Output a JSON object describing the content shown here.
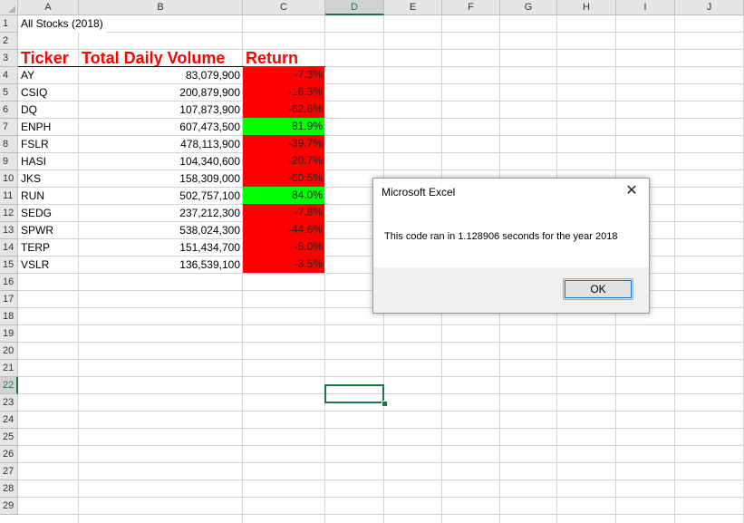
{
  "columns": [
    "A",
    "B",
    "C",
    "D",
    "E",
    "F",
    "G",
    "H",
    "I",
    "J"
  ],
  "selected_column": "D",
  "rows": [
    "1",
    "2",
    "3",
    "4",
    "5",
    "6",
    "7",
    "8",
    "9",
    "10",
    "11",
    "12",
    "13",
    "14",
    "15",
    "16",
    "17",
    "18",
    "19",
    "20",
    "21",
    "22",
    "23",
    "24",
    "25",
    "26",
    "27",
    "28",
    "29"
  ],
  "selected_row": "22",
  "sheet_title": "All Stocks (2018)",
  "headers": {
    "ticker": "Ticker",
    "volume": "Total Daily Volume",
    "return": "Return"
  },
  "colors": {
    "positive": "#00ff00",
    "negative": "#ff0000",
    "header_text": "#ff0000",
    "accent": "#217346"
  },
  "stocks": [
    {
      "ticker": "AY",
      "volume": "83,079,900",
      "return": "-7.3%",
      "positive": false
    },
    {
      "ticker": "CSIQ",
      "volume": "200,879,900",
      "return": "-16.3%",
      "positive": false
    },
    {
      "ticker": "DQ",
      "volume": "107,873,900",
      "return": "-62.6%",
      "positive": false
    },
    {
      "ticker": "ENPH",
      "volume": "607,473,500",
      "return": "81.9%",
      "positive": true
    },
    {
      "ticker": "FSLR",
      "volume": "478,113,900",
      "return": "-39.7%",
      "positive": false
    },
    {
      "ticker": "HASI",
      "volume": "104,340,600",
      "return": "-20.7%",
      "positive": false
    },
    {
      "ticker": "JKS",
      "volume": "158,309,000",
      "return": "-60.5%",
      "positive": false
    },
    {
      "ticker": "RUN",
      "volume": "502,757,100",
      "return": "84.0%",
      "positive": true
    },
    {
      "ticker": "SEDG",
      "volume": "237,212,300",
      "return": "-7.8%",
      "positive": false
    },
    {
      "ticker": "SPWR",
      "volume": "538,024,300",
      "return": "-44.6%",
      "positive": false
    },
    {
      "ticker": "TERP",
      "volume": "151,434,700",
      "return": "-5.0%",
      "positive": false
    },
    {
      "ticker": "VSLR",
      "volume": "136,539,100",
      "return": "-3.5%",
      "positive": false
    }
  ],
  "dialog": {
    "title": "Microsoft Excel",
    "close_icon": "close-icon",
    "message": "This code ran in 1.128906 seconds for the year 2018",
    "ok_label": "OK"
  }
}
